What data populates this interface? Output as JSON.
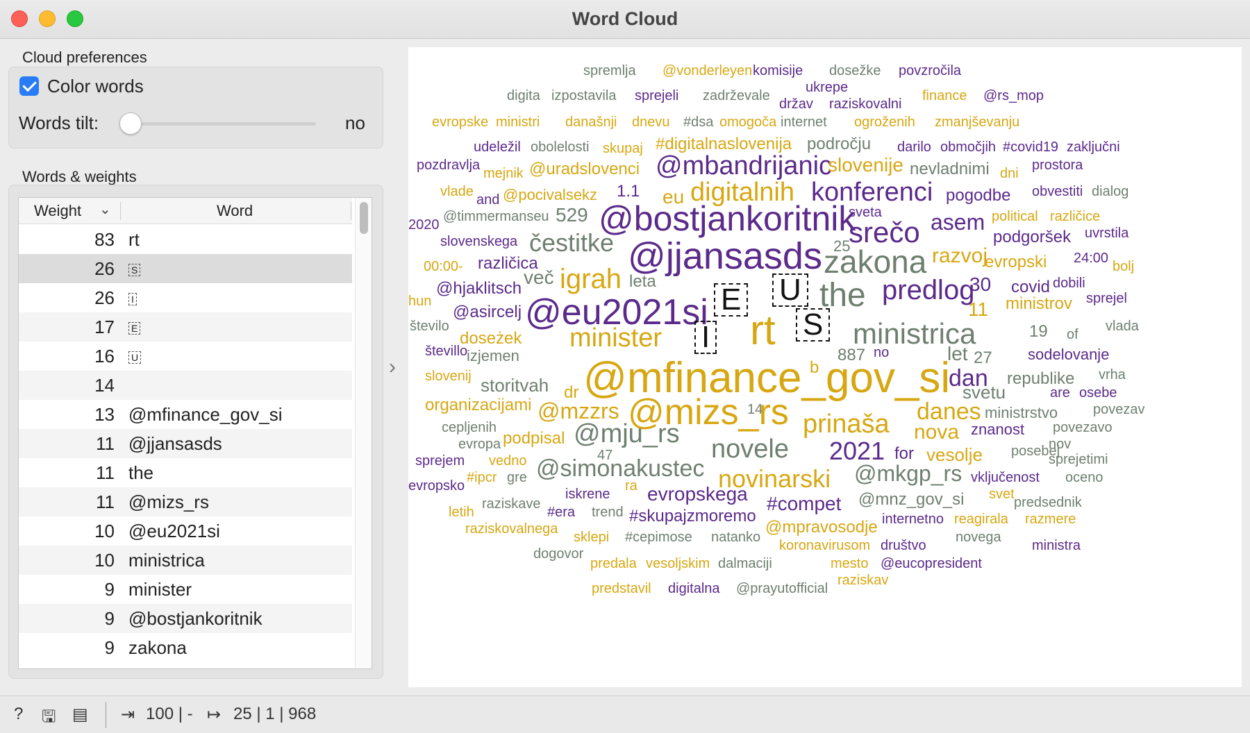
{
  "window": {
    "title": "Word Cloud"
  },
  "preferences": {
    "section_label": "Cloud preferences",
    "color_words_label": "Color words",
    "color_words_checked": true,
    "words_tilt_label": "Words tilt:",
    "words_tilt_value": "no"
  },
  "table": {
    "section_label": "Words & weights",
    "headers": {
      "weight": "Weight",
      "word": "Word"
    },
    "rows": [
      {
        "weight": "83",
        "word": "rt"
      },
      {
        "weight": "26",
        "word": "S"
      },
      {
        "weight": "26",
        "word": "I"
      },
      {
        "weight": "17",
        "word": "E"
      },
      {
        "weight": "16",
        "word": "U"
      },
      {
        "weight": "14",
        "word": ""
      },
      {
        "weight": "13",
        "word": "@mfinance_gov_si"
      },
      {
        "weight": "11",
        "word": "@jjansasds"
      },
      {
        "weight": "11",
        "word": "the"
      },
      {
        "weight": "11",
        "word": "@mizs_rs"
      },
      {
        "weight": "10",
        "word": "@eu2021si"
      },
      {
        "weight": "10",
        "word": "ministrica"
      },
      {
        "weight": "9",
        "word": "minister"
      },
      {
        "weight": "9",
        "word": "@bostjankoritnik"
      },
      {
        "weight": "9",
        "word": "zakona"
      }
    ]
  },
  "colors": {
    "gold": "#d7a712",
    "purple": "#5b2a8b",
    "gray": "#6e7f6f",
    "accent": "#2a7cf6"
  },
  "cloud_words": [
    "spremlja",
    "@vonderleyen",
    "komisije",
    "dosežke",
    "povzročila",
    "ukrepe",
    "digita",
    "izpostavila",
    "sprejeli",
    "zadrževale",
    "držav",
    "raziskovalni",
    "finance",
    "@rs_mop",
    "evropske",
    "ministri",
    "današnji",
    "dnevu",
    "#dsa",
    "omogoča",
    "internet",
    "ogroženih",
    "zmanjševanju",
    "udeležil",
    "obolelosti",
    "skupaj",
    "#digitalnaslovenija",
    "področju",
    "darilo",
    "območjih",
    "#covid19",
    "zaključni",
    "pozdravlja",
    "mejnik",
    "@uradslovenci",
    "@mbandrijanic",
    "slovenije",
    "nevladnimi",
    "dni",
    "prostora",
    "vlade",
    "and",
    "@pocivalsekz",
    "1.1",
    "eu",
    "digitalnih",
    "konferenci",
    "pogodbe",
    "obvestiti",
    "dialog",
    "2020",
    "@timmermanseu",
    "529",
    "@bostjankoritnik",
    "sveta",
    "political",
    "različice",
    "slovenskega",
    "čestitke",
    "srečo",
    "asem",
    "podgoršek",
    "uvrstila",
    "00:00-",
    "različica",
    "@jjansasds",
    "25",
    "zakona",
    "razvoj",
    "evropski",
    "24:00",
    "bolj",
    "hun",
    "več",
    "igrah",
    "leta",
    "E",
    "U",
    "the",
    "predlog",
    "30",
    "covid",
    "dobili",
    "@hjaklitsch",
    "@asircelj",
    "@eu2021si",
    "11",
    "ministrov",
    "sprejel",
    "število",
    "minister",
    "I",
    "rt",
    "S",
    "ministrica",
    "19",
    "of",
    "vlada",
    "doseżek",
    "števillo",
    "izjemen",
    "887",
    "no",
    "let",
    "27",
    "sodelovanje",
    "b",
    "@mfinance_gov_si",
    "dan",
    "republike",
    "vrha",
    "slovenij",
    "storitvah",
    "dr",
    "svetu",
    "are",
    "osebe",
    "organizacijami",
    "@mzzrs",
    "@mizs_rs",
    "14",
    "danes",
    "ministrstvo",
    "povezav",
    "prinaša",
    "cepljenih",
    "nova",
    "znanost",
    "povezavo",
    "evropa",
    "podpisal",
    "@mju_rs",
    "47",
    "novele",
    "2021",
    "for",
    "vesolje",
    "posebej",
    "nov",
    "sprejem",
    "vedno",
    "@simonakustec",
    "@mkgp_rs",
    "sprejetimi",
    "#ipcr",
    "gre",
    "novinarski",
    "vključenost",
    "oceno",
    "evropsko",
    "ra",
    "iskrene",
    "evropskega",
    "svet",
    "raziskave",
    "#era",
    "trend",
    "#compet",
    "@mnz_gov_si",
    "predsednik",
    "letih",
    "#skupajzmoremo",
    "internetno",
    "reagirala",
    "razmere",
    "raziskovalnega",
    "@mpravosodje",
    "sklepi",
    "#cepimose",
    "natanko",
    "novega",
    "koronavirusom",
    "društvo",
    "ministra",
    "dogovor",
    "predala",
    "vesoljskim",
    "dalmaciji",
    "mesto",
    "@eucopresident",
    "raziskav",
    "predstavil",
    "digitalna",
    "@prayutofficial"
  ],
  "status": {
    "input_summary": "100 | -",
    "output_summary": "25 | 1 | 968"
  }
}
